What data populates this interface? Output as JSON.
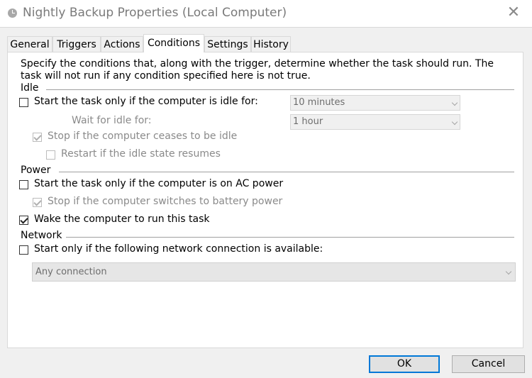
{
  "window": {
    "title": "Nightly Backup Properties (Local Computer)",
    "close_glyph": "✕",
    "icon": "task-scheduler-clock-icon"
  },
  "tabs": [
    {
      "label": "General",
      "active": false
    },
    {
      "label": "Triggers",
      "active": false
    },
    {
      "label": "Actions",
      "active": false
    },
    {
      "label": "Conditions",
      "active": true
    },
    {
      "label": "Settings",
      "active": false
    },
    {
      "label": "History",
      "active": false
    }
  ],
  "conditions": {
    "description": "Specify the conditions that, along with the trigger, determine whether the task should run.  The task will not run  if any condition specified here is not true.",
    "idle": {
      "group_label": "Idle",
      "start_only_if_idle": {
        "label": "Start the task only if the computer is idle for:",
        "checked": false,
        "enabled": true
      },
      "idle_duration": {
        "value": "10 minutes",
        "enabled": false
      },
      "wait_for_idle": {
        "label": "Wait for idle for:",
        "value": "1 hour",
        "enabled": false
      },
      "stop_if_ceases_idle": {
        "label": "Stop if the computer ceases to be idle",
        "checked": true,
        "enabled": false
      },
      "restart_if_idle_resumes": {
        "label": "Restart if the idle state resumes",
        "checked": false,
        "enabled": false
      }
    },
    "power": {
      "group_label": "Power",
      "start_only_on_ac": {
        "label": "Start the task only if the computer is on AC power",
        "checked": false,
        "enabled": true
      },
      "stop_on_battery": {
        "label": "Stop if the computer switches to battery power",
        "checked": true,
        "enabled": false
      },
      "wake_to_run": {
        "label": "Wake the computer to run this task",
        "checked": true,
        "enabled": true
      }
    },
    "network": {
      "group_label": "Network",
      "start_only_if_network": {
        "label": "Start only if the following network connection is available:",
        "checked": false,
        "enabled": true
      },
      "connection": {
        "value": "Any connection",
        "enabled": false
      }
    }
  },
  "buttons": {
    "ok": "OK",
    "cancel": "Cancel"
  },
  "colors": {
    "accent": "#0078d7",
    "window_bg": "#f0f0f0",
    "panel_bg": "#ffffff",
    "disabled_text": "#8a8a8a"
  }
}
